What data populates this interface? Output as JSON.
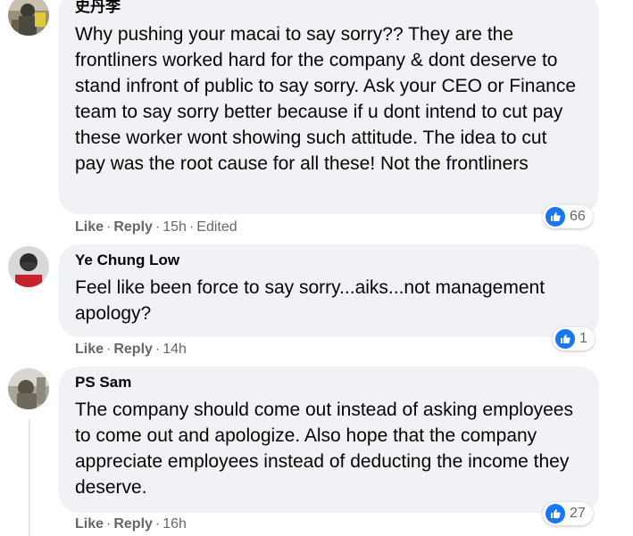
{
  "comments": [
    {
      "author": "史丹李",
      "text": "Why pushing your macai to say sorry?? They are the frontliners worked hard for the company & dont deserve to stand infront of public to say sorry. Ask your CEO or Finance team to say sorry better because if u dont intend to cut pay these worker wont showing such attitude. The idea to cut pay was the root cause for all these! Not the frontliners",
      "like_label": "Like",
      "reply_label": "Reply",
      "time": "15h",
      "edited": "Edited",
      "reaction_count": "66",
      "reaction_icon": "thumbs-up-icon"
    },
    {
      "author": "Ye Chung Low",
      "text": "Feel like been force to say sorry...aiks...not management apology?",
      "like_label": "Like",
      "reply_label": "Reply",
      "time": "14h",
      "reaction_count": "1",
      "reaction_icon": "thumbs-up-icon"
    },
    {
      "author": "PS Sam",
      "text": "The company should come out instead of asking employees to come out and apologize. Also hope that the company appreciate employees instead of deducting the income they deserve.",
      "like_label": "Like",
      "reply_label": "Reply",
      "time": "16h",
      "reaction_count": "27",
      "reaction_icon": "thumbs-up-icon"
    }
  ],
  "colors": {
    "bubble": "#f0f2f5",
    "meta_text": "#65676b",
    "like_blue": "#1877f2"
  }
}
